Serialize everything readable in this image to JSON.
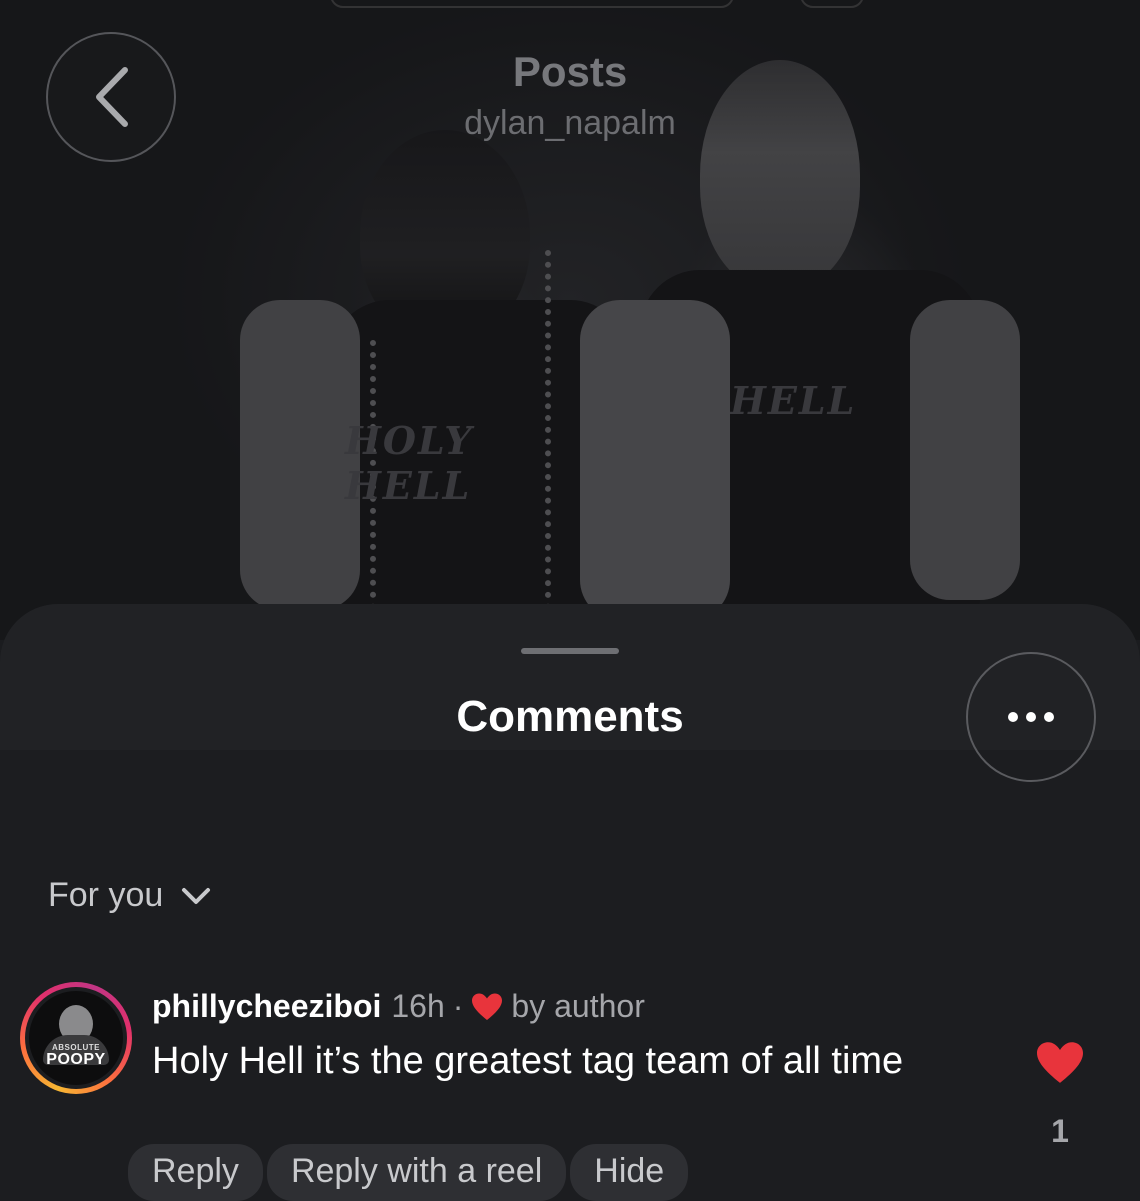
{
  "header": {
    "title": "Posts",
    "subtitle": "dylan_napalm"
  },
  "photo": {
    "shirt_text_left": "HOLY HELL",
    "shirt_text_right": "HELL"
  },
  "sheet": {
    "title": "Comments",
    "filter_label": "For you"
  },
  "comments": [
    {
      "username": "phillycheeziboi",
      "time": "16h",
      "separator": "·",
      "liked_by_label": "by author",
      "text": "Holy Hell it’s the greatest tag team of all time",
      "like_count": "1",
      "avatar_brand_small": "ABSOLUTE",
      "avatar_brand_big": "POOPY",
      "actions": [
        "Reply",
        "Reply with a reel",
        "Hide"
      ]
    }
  ],
  "colors": {
    "heart": "#e8343c",
    "story_ring": [
      "#f7b733",
      "#e1306c",
      "#c13584"
    ]
  },
  "icons": {
    "back": "chevron-left-icon",
    "more": "ellipsis-icon",
    "filter": "chevron-down-icon",
    "like": "heart-icon"
  }
}
